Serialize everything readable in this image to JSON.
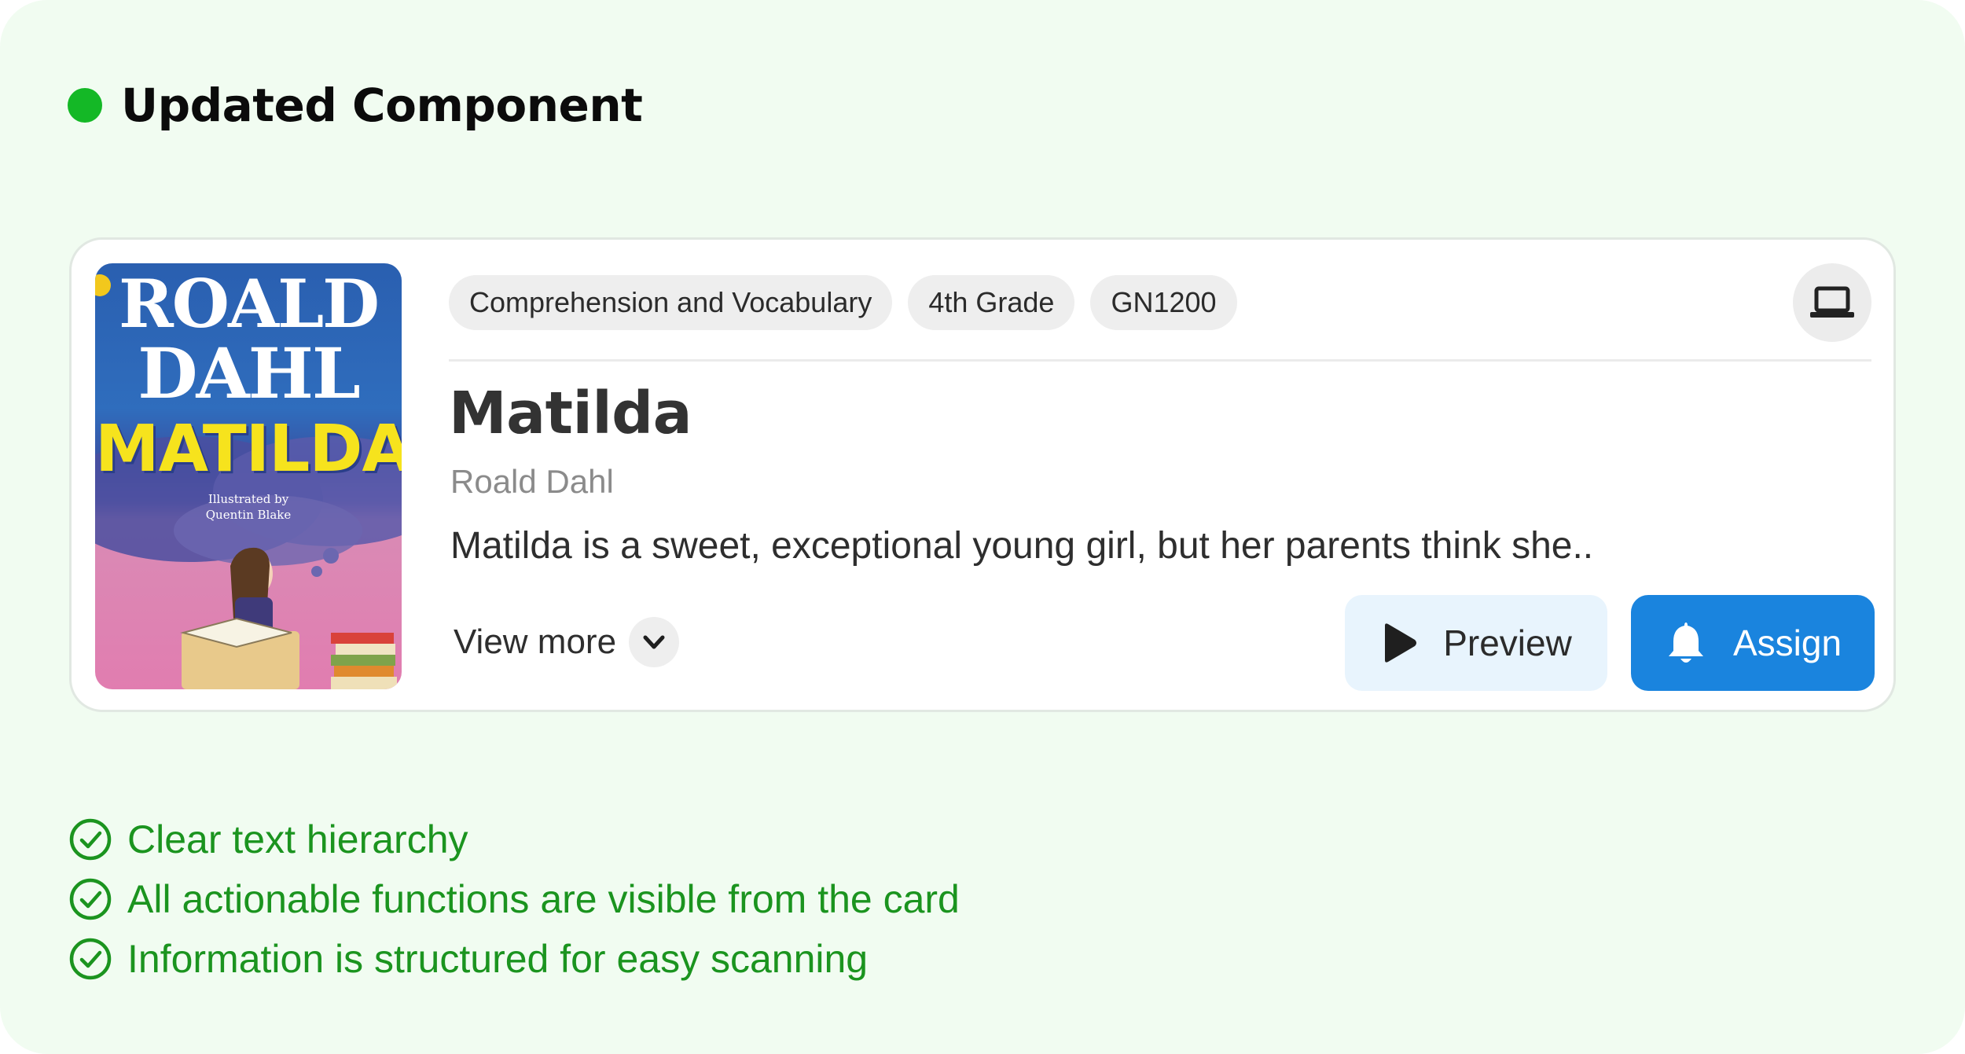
{
  "header": {
    "title": "Updated Component",
    "status_color": "#14b826"
  },
  "card": {
    "cover": {
      "author_line1": "ROALD",
      "author_line2": "DAHL",
      "title": "MATILDA",
      "illustrator_line1": "Illustrated by",
      "illustrator_line2": "Quentin Blake"
    },
    "tags": [
      "Comprehension and Vocabulary",
      "4th Grade",
      "GN1200"
    ],
    "device_icon": "laptop-icon",
    "title": "Matilda",
    "author": "Roald Dahl",
    "description": "Matilda is a sweet, exceptional young girl, but her parents think she..",
    "view_more_label": "View more",
    "preview_label": "Preview",
    "assign_label": "Assign",
    "assign_color": "#1a84de",
    "preview_bg": "#e8f4fd"
  },
  "checklist": [
    "Clear text hierarchy",
    "All actionable functions are visible from the card",
    "Information is structured for easy scanning"
  ],
  "check_color": "#1b941f"
}
